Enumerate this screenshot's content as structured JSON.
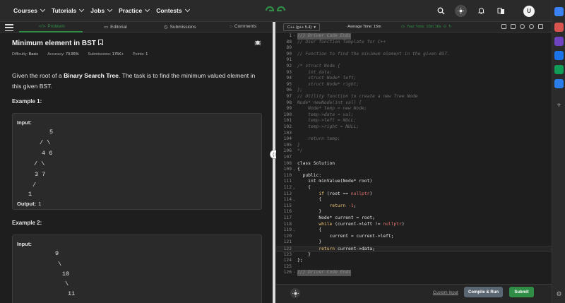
{
  "nav": {
    "menu": [
      {
        "label": "Courses"
      },
      {
        "label": "Tutorials"
      },
      {
        "label": "Jobs"
      },
      {
        "label": "Practice"
      },
      {
        "label": "Contests"
      }
    ],
    "avatar_letter": "U",
    "brand_color": "#2f8d46"
  },
  "tabs": [
    {
      "label": "Problem",
      "icon": "code-icon"
    },
    {
      "label": "Editorial",
      "icon": "book-icon"
    },
    {
      "label": "Submissions",
      "icon": "clock-icon"
    },
    {
      "label": "Comments",
      "icon": "comment-icon"
    }
  ],
  "problem": {
    "title": "Minimum element in BST",
    "meta": [
      {
        "key": "Difficulty:",
        "value": "Basic"
      },
      {
        "key": "Accuracy:",
        "value": "70.95%"
      },
      {
        "key": "Submissions:",
        "value": "175K+"
      },
      {
        "key": "Points:",
        "value": "1"
      }
    ],
    "desc_pre": "Given the root of a ",
    "desc_bold": "Binary Search Tree",
    "desc_post": ". The task is to find the minimum valued element in this given BST.",
    "example1": {
      "label": "Example 1:",
      "input_label": "Input:",
      "tree": [
        "5",
        "/    \\",
        "4      6",
        "/      \\",
        "3          7",
        "/",
        "1"
      ],
      "output_label": "Output:",
      "output_value": "1"
    },
    "example2": {
      "label": "Example 2:",
      "input_label": "Input:",
      "tree": [
        "9",
        "\\",
        "10",
        "\\",
        "11"
      ]
    }
  },
  "editor": {
    "language": "C++ (g++ 5.4)",
    "avg_time": "Average Time: 15m",
    "your_time": "Your Time: 10m 18s",
    "custom_input": "Custom Input",
    "compile_run": "Compile & Run",
    "submit": "Submit",
    "lines": [
      {
        "n": "1",
        "fold": "›",
        "t": "//} Driver Code Ends",
        "c": "hl"
      },
      {
        "n": "88",
        "fold": "",
        "t": "// User function Template for C++",
        "c": "com"
      },
      {
        "n": "89",
        "fold": "",
        "t": "",
        "c": ""
      },
      {
        "n": "90",
        "fold": "",
        "t": "// Function to find the minimum element in the given BST.",
        "c": "com"
      },
      {
        "n": "91",
        "fold": "",
        "t": "",
        "c": ""
      },
      {
        "n": "92",
        "fold": "",
        "t": "/* struct Node {",
        "c": "com"
      },
      {
        "n": "93",
        "fold": "",
        "t": "    int data;",
        "c": "com"
      },
      {
        "n": "94",
        "fold": "",
        "t": "    struct Node* left;",
        "c": "com"
      },
      {
        "n": "95",
        "fold": "",
        "t": "    struct Node* right;",
        "c": "com"
      },
      {
        "n": "96",
        "fold": "",
        "t": "};",
        "c": "com"
      },
      {
        "n": "97",
        "fold": "",
        "t": "// Utility function to create a new Tree Node",
        "c": "com"
      },
      {
        "n": "98",
        "fold": "",
        "t": "Node* newNode(int val) {",
        "c": "com"
      },
      {
        "n": "99",
        "fold": "",
        "t": "    Node* temp = new Node;",
        "c": "com"
      },
      {
        "n": "100",
        "fold": "",
        "t": "    temp->data = val;",
        "c": "com"
      },
      {
        "n": "101",
        "fold": "",
        "t": "    temp->left = NULL;",
        "c": "com"
      },
      {
        "n": "102",
        "fold": "",
        "t": "    temp->right = NULL;",
        "c": "com"
      },
      {
        "n": "103",
        "fold": "",
        "t": "",
        "c": ""
      },
      {
        "n": "104",
        "fold": "",
        "t": "    return temp;",
        "c": "com"
      },
      {
        "n": "105",
        "fold": "",
        "t": "}",
        "c": "com"
      },
      {
        "n": "106",
        "fold": "",
        "t": "*/",
        "c": "com"
      },
      {
        "n": "107",
        "fold": "",
        "t": "",
        "c": ""
      },
      {
        "n": "108",
        "fold": "",
        "t": "class Solution",
        "c": ""
      },
      {
        "n": "109",
        "fold": "⌄",
        "t": "{",
        "c": ""
      },
      {
        "n": "110",
        "fold": "",
        "t": "  public:",
        "c": ""
      },
      {
        "n": "111",
        "fold": "",
        "t": "    int minValue(Node* root)",
        "c": ""
      },
      {
        "n": "112",
        "fold": "⌄",
        "t": "    {",
        "c": ""
      },
      {
        "n": "113",
        "fold": "",
        "t": "        if (root == nullptr)",
        "c": "if"
      },
      {
        "n": "114",
        "fold": "⌄",
        "t": "        {",
        "c": ""
      },
      {
        "n": "115",
        "fold": "",
        "t": "            return -1;",
        "c": "ret"
      },
      {
        "n": "116",
        "fold": "",
        "t": "        }",
        "c": ""
      },
      {
        "n": "117",
        "fold": "",
        "t": "        Node* current = root;",
        "c": ""
      },
      {
        "n": "118",
        "fold": "",
        "t": "        while (current->left != nullptr)",
        "c": "while"
      },
      {
        "n": "119",
        "fold": "⌄",
        "t": "        {",
        "c": ""
      },
      {
        "n": "120",
        "fold": "",
        "t": "            current = current->left;",
        "c": ""
      },
      {
        "n": "121",
        "fold": "",
        "t": "        }",
        "c": ""
      },
      {
        "n": "122",
        "fold": "",
        "t": "        return current->data;",
        "c": "ret2"
      },
      {
        "n": "123",
        "fold": "",
        "t": "    }",
        "c": ""
      },
      {
        "n": "124",
        "fold": "",
        "t": "};",
        "c": ""
      },
      {
        "n": "125",
        "fold": "",
        "t": "",
        "c": ""
      },
      {
        "n": "126",
        "fold": "›",
        "t": "//} Driver Code Ends",
        "c": "hl"
      }
    ]
  }
}
